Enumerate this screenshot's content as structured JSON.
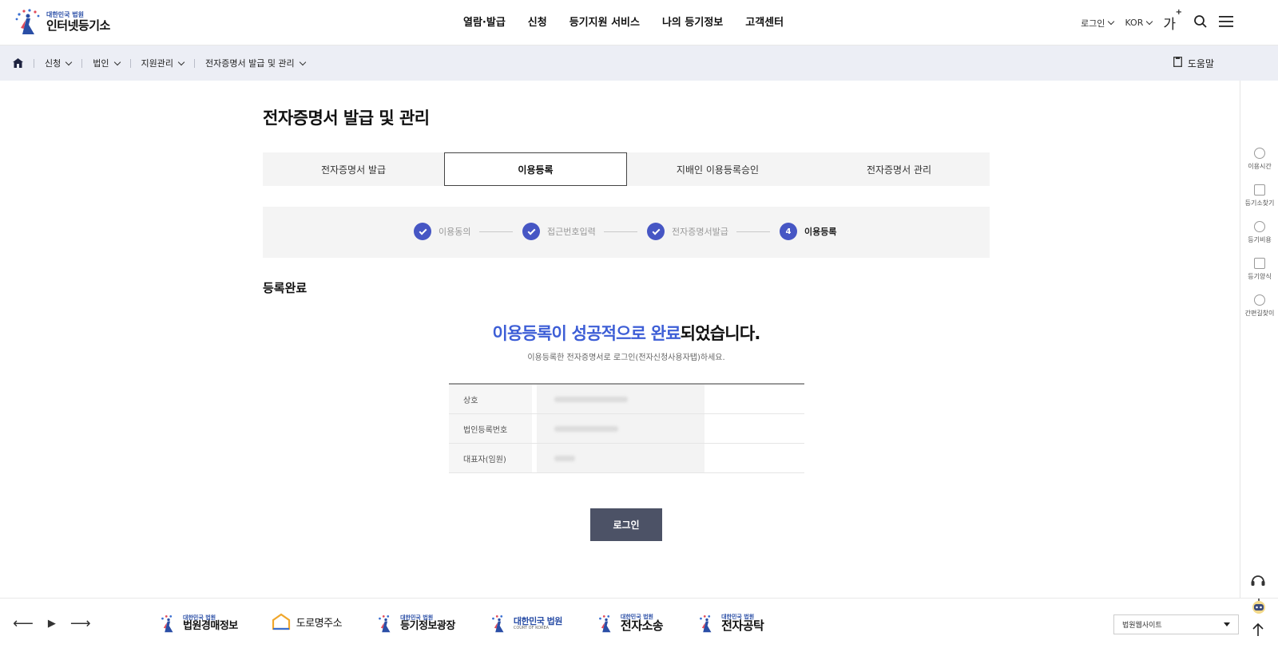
{
  "header": {
    "logo_small": "대한민국 법원",
    "logo_big": "인터넷등기소",
    "nav": [
      "열람·발급",
      "신청",
      "등기지원 서비스",
      "나의 등기정보",
      "고객센터"
    ],
    "login": "로그인",
    "lang": "KOR",
    "font_label": "가"
  },
  "breadcrumb": {
    "items": [
      "신청",
      "법인",
      "지원관리",
      "전자증명서 발급 및 관리"
    ],
    "help": "도움말"
  },
  "quick_menu": [
    "이용시간",
    "등기소찾기",
    "등기비용",
    "등기양식",
    "간편길찾이"
  ],
  "page": {
    "title": "전자증명서 발급 및 관리",
    "tabs": [
      "전자증명서 발급",
      "이용등록",
      "지배인 이용등록승인",
      "전자증명서 관리"
    ],
    "active_tab": 1,
    "steps": [
      {
        "label": "이용동의",
        "done": true
      },
      {
        "label": "접근번호입력",
        "done": true
      },
      {
        "label": "전자증명서발급",
        "done": true
      },
      {
        "label": "이용등록",
        "number": "4",
        "current": true
      }
    ],
    "section_title": "등록완료",
    "message_highlight": "이용등록이 성공적으로 완료",
    "message_rest": "되었습니다.",
    "sub_message": "이용등록한 전자증명서로 로그인(전자신청사용자탭)하세요.",
    "info_rows": [
      {
        "label": "상호"
      },
      {
        "label": "법인등록번호"
      },
      {
        "label": "대표자(임원)"
      }
    ],
    "login_button": "로그인"
  },
  "footer": {
    "banners": [
      {
        "small": "대한민국 법원",
        "large": "법원경매정보"
      },
      {
        "small": "",
        "large": "도로명주소"
      },
      {
        "small": "대한민국 법원",
        "large": "등기정보광장"
      },
      {
        "small": "",
        "large": "대한민국 법원",
        "sub": "COURT OF KOREA"
      },
      {
        "small": "대한민국 법원",
        "large": "전자소송"
      },
      {
        "small": "대한민국 법원",
        "large": "전자공탁"
      }
    ],
    "site_select": "법원웹사이트"
  },
  "colors": {
    "accent": "#4656c4",
    "highlight": "#3d5ed6",
    "button": "#4c5266",
    "crumb_bg": "#eceef5"
  }
}
